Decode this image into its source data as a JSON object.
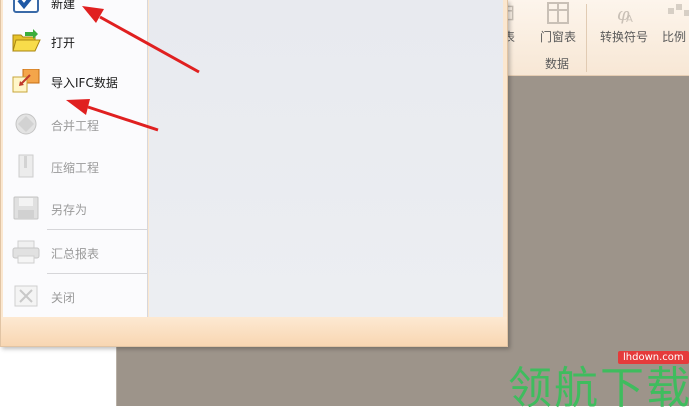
{
  "ribbon": {
    "buttons": [
      {
        "label": "表",
        "icon": "table-icon"
      },
      {
        "label": "门窗表",
        "icon": "door-window-table-icon"
      },
      {
        "label": "转换符号",
        "icon": "convert-symbol-icon"
      },
      {
        "label": "比例",
        "icon": "scale-icon"
      }
    ],
    "group_label": "数据"
  },
  "menu": {
    "items": [
      {
        "label": "新建",
        "icon": "new-check-icon",
        "enabled": true
      },
      {
        "label": "打开",
        "icon": "open-folder-icon",
        "enabled": true
      },
      {
        "label": "导入IFC数据",
        "icon": "import-ifc-icon",
        "enabled": true
      },
      {
        "label": "合并工程",
        "icon": "merge-project-icon",
        "enabled": false
      },
      {
        "label": "压缩工程",
        "icon": "compress-project-icon",
        "enabled": false
      },
      {
        "label": "另存为",
        "icon": "save-as-icon",
        "enabled": false
      },
      {
        "label": "汇总报表",
        "icon": "summary-report-icon",
        "enabled": false
      },
      {
        "label": "关闭",
        "icon": "close-icon",
        "enabled": false
      }
    ]
  },
  "watermark": {
    "site": "lhdown.com",
    "text": "领航下载"
  },
  "colors": {
    "annotation_arrow": "#e02020",
    "workspace": "#9d948a",
    "menu_frame": "#fbe7cf"
  }
}
